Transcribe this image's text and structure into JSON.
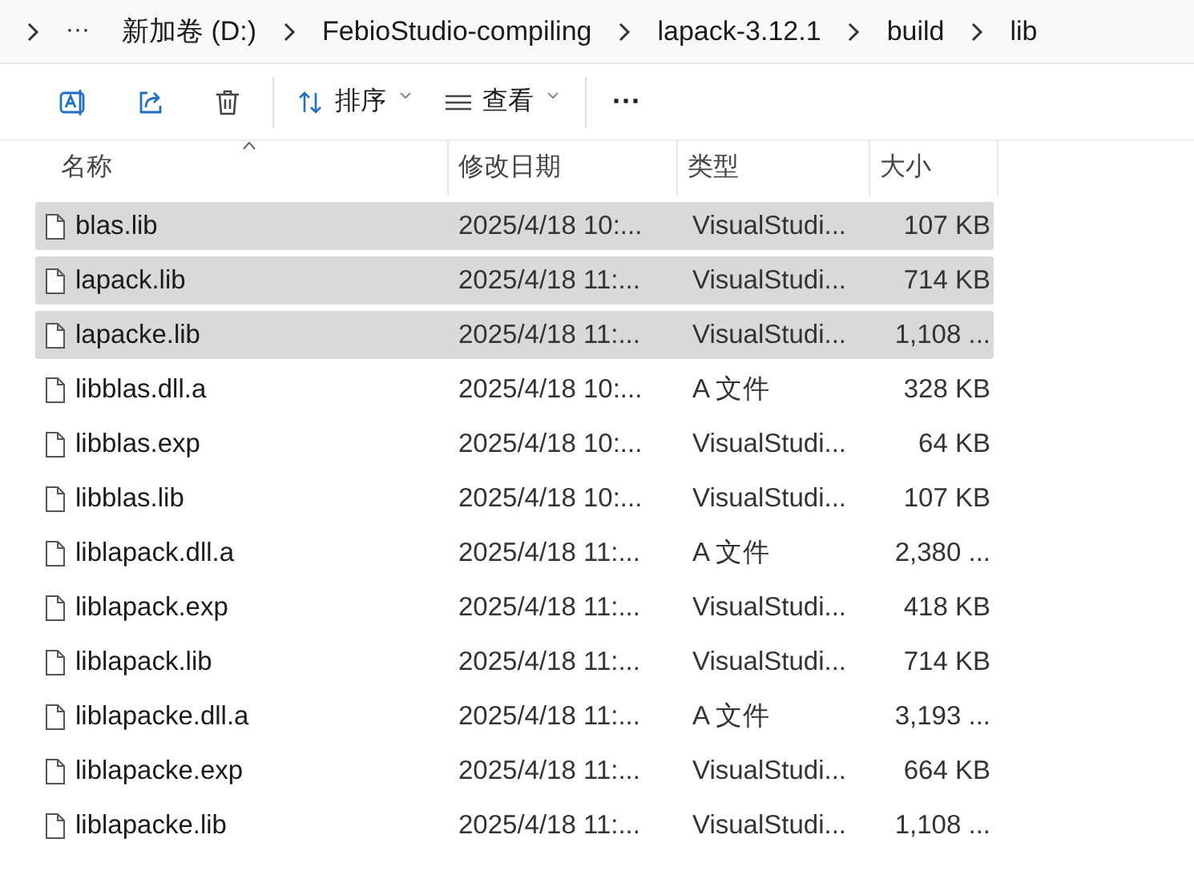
{
  "breadcrumb": {
    "overflow": "···",
    "items": [
      "新加卷 (D:)",
      "FebioStudio-compiling",
      "lapack-3.12.1",
      "build",
      "lib"
    ]
  },
  "toolbar": {
    "sort": "排序",
    "view": "查看",
    "more": "···"
  },
  "columns": [
    "名称",
    "修改日期",
    "类型",
    "大小"
  ],
  "files": [
    {
      "name": "blas.lib",
      "date": "2025/4/18 10:...",
      "type": "VisualStudi...",
      "size": "107 KB",
      "selected": true
    },
    {
      "name": "lapack.lib",
      "date": "2025/4/18 11:...",
      "type": "VisualStudi...",
      "size": "714 KB",
      "selected": true
    },
    {
      "name": "lapacke.lib",
      "date": "2025/4/18 11:...",
      "type": "VisualStudi...",
      "size": "1,108 ...",
      "selected": true
    },
    {
      "name": "libblas.dll.a",
      "date": "2025/4/18 10:...",
      "type": "A 文件",
      "size": "328 KB",
      "selected": false
    },
    {
      "name": "libblas.exp",
      "date": "2025/4/18 10:...",
      "type": "VisualStudi...",
      "size": "64 KB",
      "selected": false
    },
    {
      "name": "libblas.lib",
      "date": "2025/4/18 10:...",
      "type": "VisualStudi...",
      "size": "107 KB",
      "selected": false
    },
    {
      "name": "liblapack.dll.a",
      "date": "2025/4/18 11:...",
      "type": "A 文件",
      "size": "2,380 ...",
      "selected": false
    },
    {
      "name": "liblapack.exp",
      "date": "2025/4/18 11:...",
      "type": "VisualStudi...",
      "size": "418 KB",
      "selected": false
    },
    {
      "name": "liblapack.lib",
      "date": "2025/4/18 11:...",
      "type": "VisualStudi...",
      "size": "714 KB",
      "selected": false
    },
    {
      "name": "liblapacke.dll.a",
      "date": "2025/4/18 11:...",
      "type": "A 文件",
      "size": "3,193 ...",
      "selected": false
    },
    {
      "name": "liblapacke.exp",
      "date": "2025/4/18 11:...",
      "type": "VisualStudi...",
      "size": "664 KB",
      "selected": false
    },
    {
      "name": "liblapacke.lib",
      "date": "2025/4/18 11:...",
      "type": "VisualStudi...",
      "size": "1,108 ...",
      "selected": false
    }
  ]
}
